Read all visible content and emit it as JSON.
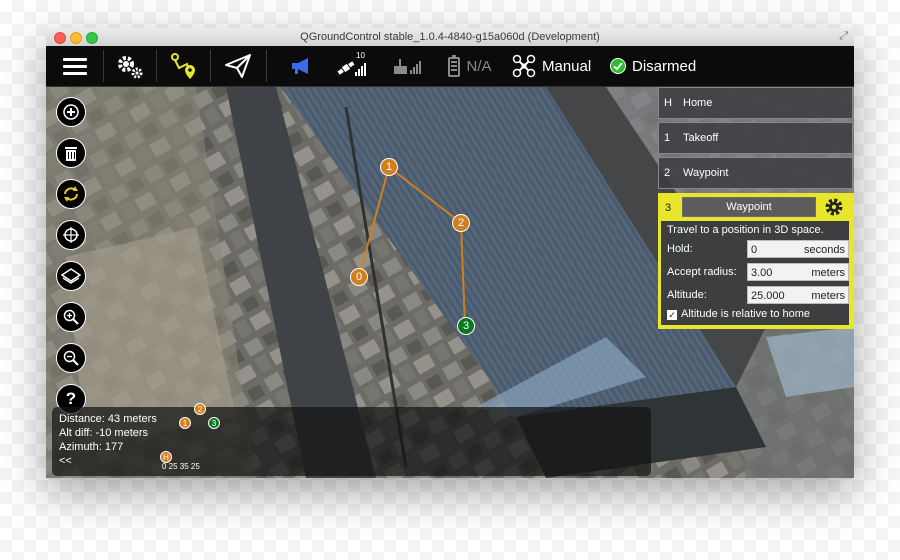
{
  "window": {
    "title": "QGroundControl stable_1.0.4-4840-g15a060d (Development)"
  },
  "toolbar": {
    "menu_icon": "hamburger-icon",
    "settings_icon": "gears-icon",
    "plan_icon": "mission-plan-icon",
    "fly_icon": "paper-plane-icon",
    "messages_icon": "megaphone-icon",
    "gps_count": "10",
    "flight_mode": "Manual",
    "arm_status": "Disarmed",
    "battery": "N/A",
    "colors": {
      "bg": "#0b0b0b",
      "accent_blue": "#3b6cf0",
      "armed_green": "#2ebd2e"
    }
  },
  "left_tools": [
    "add",
    "delete",
    "sync",
    "center",
    "layers",
    "zoom-in",
    "zoom-out",
    "help"
  ],
  "waypoints": [
    {
      "label": "0",
      "color": "orange"
    },
    {
      "label": "1",
      "color": "orange"
    },
    {
      "label": "2",
      "color": "orange"
    },
    {
      "label": "3",
      "color": "green"
    }
  ],
  "mission_list": [
    {
      "num": "H",
      "label": "Home"
    },
    {
      "num": "1",
      "label": "Takeoff"
    },
    {
      "num": "2",
      "label": "Waypoint"
    }
  ],
  "editor": {
    "num": "3",
    "type": "Waypoint",
    "description": "Travel to a position in 3D space.",
    "fields": [
      {
        "key": "Hold:",
        "value": "0",
        "unit": "seconds"
      },
      {
        "key": "Accept radius:",
        "value": "3.00",
        "unit": "meters"
      },
      {
        "key": "Altitude:",
        "value": "25.000",
        "unit": "meters"
      }
    ],
    "checkbox_label": "Altitude is relative to home",
    "checkbox_checked": true
  },
  "info_panel": {
    "distance": "Distance: 43 meters",
    "alt_diff": "Alt diff: -10 meters",
    "azimuth": "Azimuth: 177",
    "collapse": "<<",
    "profile_home": "H",
    "profile_labels": "0 25 35 25",
    "profile_points": [
      "1",
      "2",
      "3"
    ]
  }
}
